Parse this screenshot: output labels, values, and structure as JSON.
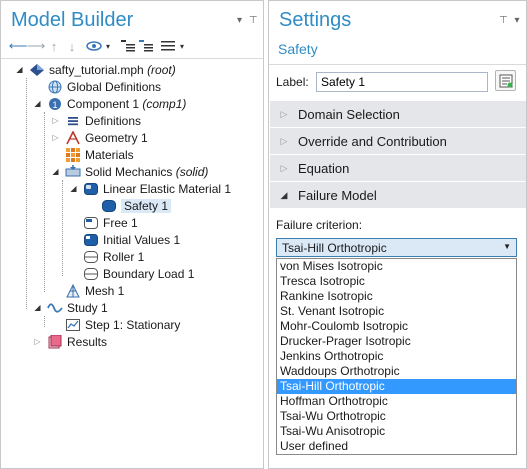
{
  "model_builder": {
    "title": "Model Builder",
    "tree": {
      "root": "safty_tutorial.mph",
      "root_suffix": "(root)",
      "global_definitions": "Global Definitions",
      "component": "Component 1",
      "component_suffix": "(comp1)",
      "definitions": "Definitions",
      "geometry": "Geometry 1",
      "materials": "Materials",
      "solid_mechanics": "Solid Mechanics",
      "solid_mechanics_suffix": "(solid)",
      "linear_elastic": "Linear Elastic Material 1",
      "safety": "Safety 1",
      "free": "Free 1",
      "initial_values": "Initial Values 1",
      "roller": "Roller 1",
      "boundary_load": "Boundary Load 1",
      "mesh": "Mesh 1",
      "study": "Study 1",
      "step": "Step 1: Stationary",
      "results": "Results"
    }
  },
  "settings": {
    "title": "Settings",
    "subtitle": "Safety",
    "label_caption": "Label:",
    "label_value": "Safety 1",
    "sections": {
      "domain_selection": "Domain Selection",
      "override": "Override and Contribution",
      "equation": "Equation",
      "failure_model": "Failure Model"
    },
    "failure_criterion_label": "Failure criterion:",
    "selected_criterion": "Tsai-Hill Orthotropic",
    "options": [
      "von Mises Isotropic",
      "Tresca Isotropic",
      "Rankine Isotropic",
      "St. Venant Isotropic",
      "Mohr-Coulomb Isotropic",
      "Drucker-Prager Isotropic",
      "Jenkins Orthotropic",
      "Waddoups Orthotropic",
      "Tsai-Hill Orthotropic",
      "Hoffman Orthotropic",
      "Tsai-Wu Orthotropic",
      "Tsai-Wu Anisotropic",
      "User defined"
    ],
    "highlighted_index": 8
  },
  "colors": {
    "accent": "#2f8cc4",
    "selection": "#dbe9f7",
    "dropdown_highlight": "#3399ff",
    "section_header": "#e4e6e9"
  }
}
